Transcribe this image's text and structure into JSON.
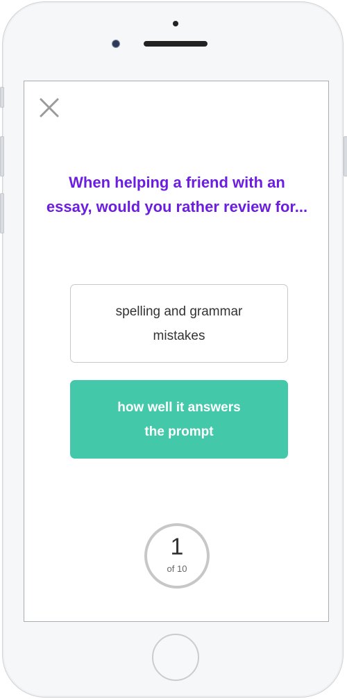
{
  "quiz": {
    "question": "When helping a friend with an essay, would you rather review for...",
    "options": [
      {
        "label": "spelling and grammar mistakes",
        "selected": false
      },
      {
        "label": "how well it answers the prompt",
        "selected": true
      }
    ],
    "progress": {
      "current": "1",
      "total_label": "of 10"
    }
  },
  "icons": {
    "close": "close-icon"
  },
  "colors": {
    "question": "#6b1ee0",
    "selected_option": "#43c8aa",
    "progress_ring": "#c7c7c7"
  }
}
